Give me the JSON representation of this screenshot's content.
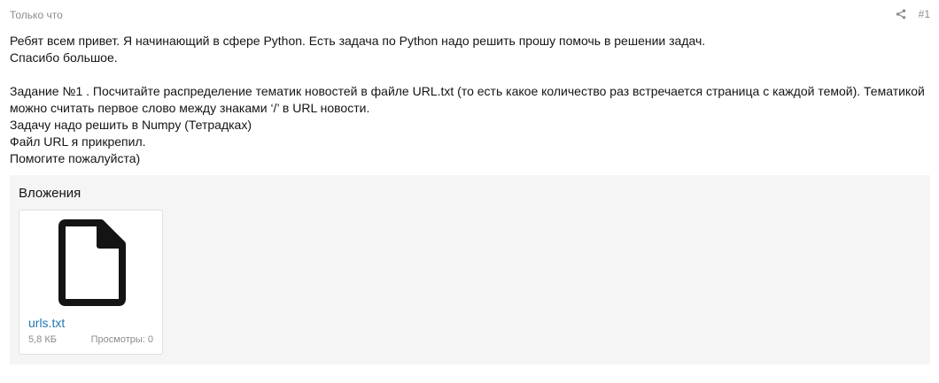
{
  "post": {
    "timestamp": "Только что",
    "number": "#1",
    "share_icon": "share-icon",
    "message": {
      "line1": "Ребят всем привет. Я начинающий в сфере Python. Есть задача по Python надо решить прошу помочь в решении задач.",
      "line2": "Спасибо большое.",
      "line3": "Задание №1 . Посчитайте распределение тематик новостей в файле URL.txt (то есть какое количество раз встречается страница с каждой темой). Тематикой можно считать первое слово между знаками ‘/’ в URL новости.",
      "line4": "Задачу надо решить в Numpy (Тетрадках)",
      "line5": "Файл URL я прикрепил.",
      "line6": "Помогите пожалуйста)"
    },
    "attachments": {
      "title": "Вложения",
      "items": [
        {
          "icon": "file-icon",
          "name": "urls.txt",
          "size": "5,8 КБ",
          "views_label": "Просмотры:",
          "views_count": "0"
        }
      ]
    }
  }
}
